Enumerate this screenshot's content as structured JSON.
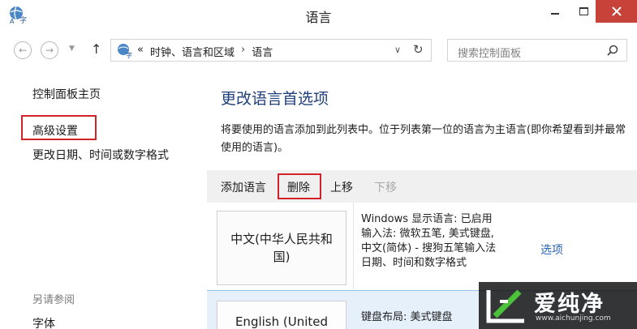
{
  "window": {
    "title": "语言"
  },
  "address": {
    "prefix": "«",
    "crumbs": [
      "时钟、语言和区域",
      "语言"
    ],
    "separator": "›"
  },
  "search": {
    "placeholder": "搜索控制面板"
  },
  "left_pane": {
    "links": [
      "控制面板主页",
      "高级设置",
      "更改日期、时间或数字格式"
    ],
    "see_also_heading": "另请参阅",
    "see_also_links": [
      "字体"
    ]
  },
  "main": {
    "title": "更改语言首选项",
    "description": "将要使用的语言添加到此列表中。位于列表第一位的语言为主语言(即你希望看到并最常使用的语言)。",
    "toolbar": {
      "add": "添加语言",
      "remove": "删除",
      "move_up": "上移",
      "move_down": "下移"
    },
    "languages": [
      {
        "name": "中文(中华人民共和国)",
        "details": [
          "Windows 显示语言: 已启用",
          "输入法: 微软五笔, 美式键盘,",
          "中文(简体) - 搜狗五笔输入法",
          "日期、时间和数字格式"
        ],
        "options_label": "选项"
      },
      {
        "name": "English (United",
        "details": [
          "键盘布局: 美式键盘"
        ]
      }
    ]
  },
  "watermark": {
    "brand": "爱纯净",
    "url": "www.aichunjing.com"
  },
  "colors": {
    "highlight_border": "#d2232a",
    "title_blue": "#1f3f7a",
    "link_blue": "#2a65b6",
    "close_red": "#c7433a"
  }
}
